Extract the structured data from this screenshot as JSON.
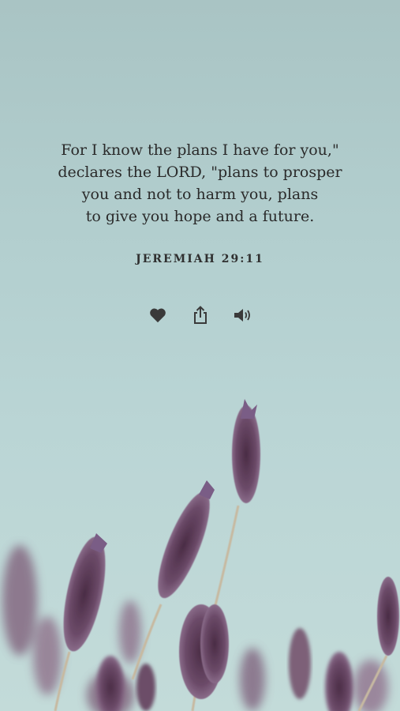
{
  "verse": {
    "lines": [
      "For I know the plans I have for you,\"",
      "declares the LORD, \"plans to prosper",
      "you and not to harm you, plans",
      "to give you hope and a future."
    ],
    "reference": "JEREMIAH 29:11"
  },
  "actions": {
    "like_icon": "heart-icon",
    "share_icon": "share-icon",
    "audio_icon": "speaker-icon"
  },
  "colors": {
    "text": "#2a2a2a",
    "icon": "#3a3a3a",
    "sky": "#b3cfcf",
    "lavender": "#5e3f5c"
  }
}
